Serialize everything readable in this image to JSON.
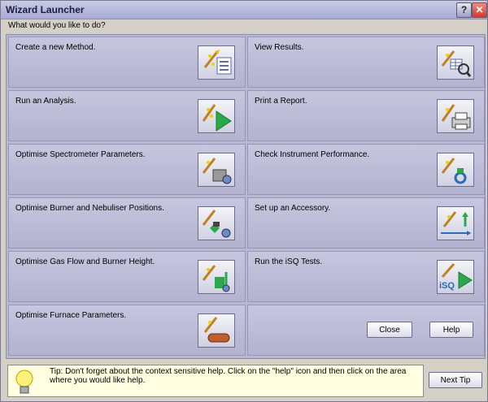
{
  "window": {
    "title": "Wizard Launcher"
  },
  "prompt": "What would you like to do?",
  "tasks": [
    {
      "label": "Create a new Method.",
      "icon": "new-method-icon"
    },
    {
      "label": "View Results.",
      "icon": "view-results-icon"
    },
    {
      "label": "Run an Analysis.",
      "icon": "run-analysis-icon"
    },
    {
      "label": "Print a Report.",
      "icon": "print-report-icon"
    },
    {
      "label": "Optimise Spectrometer Parameters.",
      "icon": "spectrometer-params-icon"
    },
    {
      "label": "Check Instrument Performance.",
      "icon": "instrument-performance-icon"
    },
    {
      "label": "Optimise Burner and Nebuliser Positions.",
      "icon": "burner-nebuliser-icon"
    },
    {
      "label": "Set up an Accessory.",
      "icon": "accessory-icon"
    },
    {
      "label": "Optimise Gas Flow and Burner Height.",
      "icon": "gas-flow-icon"
    },
    {
      "label": "Run the iSQ Tests.",
      "icon": "isq-tests-icon",
      "icon_text": "iSQ"
    },
    {
      "label": "Optimise Furnace Parameters.",
      "icon": "furnace-params-icon"
    }
  ],
  "buttons": {
    "close": "Close",
    "help": "Help",
    "next_tip": "Next Tip"
  },
  "titlebar_buttons": {
    "help": "?",
    "close": "✕"
  },
  "tip": "Tip: Don't forget about the context sensitive help. Click on the \"help\" icon and then click on the area where you would like help."
}
